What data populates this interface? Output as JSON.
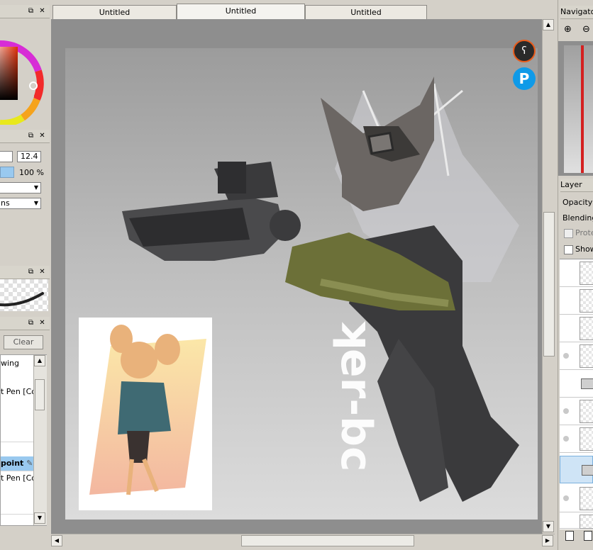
{
  "tabs": [
    {
      "label": "Untitled",
      "active": false
    },
    {
      "label": "Untitled",
      "active": true
    },
    {
      "label": "Untitled",
      "active": false
    }
  ],
  "brush_panel": {
    "size_value": "12.4",
    "density_value": "100 %",
    "dropdown_2": "ns"
  },
  "tool_panel": {
    "clear_label": "Clear",
    "tools": [
      "wing",
      "",
      "t Pen [Co",
      "",
      "",
      "",
      "point",
      "t Pen [Co",
      "",
      ""
    ]
  },
  "navigator": {
    "title": "Navigato"
  },
  "layer_panel": {
    "title": "Layer",
    "opacity_label": "Opacity",
    "blending_label": "Blending",
    "protect_label": "Prote",
    "show_label": "Show"
  },
  "canvas": {
    "watermark_text": "ʞer-bc",
    "bg_top": "#9c9c9c",
    "bg_bottom": "#e2e2e2"
  },
  "colors": {
    "selection": "#99c9ef",
    "app_bg": "#d4d0c8",
    "workspace": "#8e8e8e"
  }
}
